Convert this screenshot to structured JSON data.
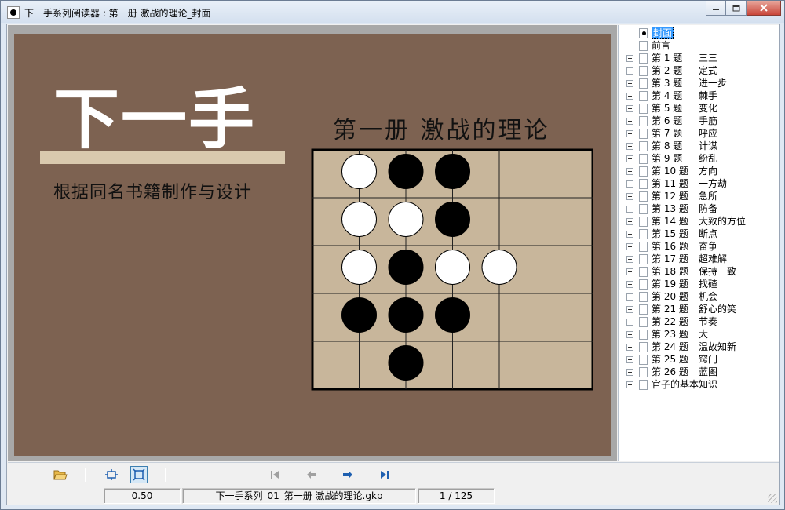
{
  "window": {
    "title": "下一手系列阅读器 : 第一册  激战的理论_封面",
    "min_icon": "minimize-icon",
    "max_icon": "maximize-icon",
    "close_icon": "close-icon"
  },
  "page": {
    "big_title": "下一手",
    "subtitle": "根据同名书籍制作与设计",
    "book_title": "第一册  激战的理论",
    "background_color": "#7d6251",
    "board_color": "#c8b69b"
  },
  "board": {
    "columns": 6,
    "rows": 5,
    "stones": [
      {
        "col": 1,
        "row": 1,
        "color": "white"
      },
      {
        "col": 2,
        "row": 1,
        "color": "black"
      },
      {
        "col": 3,
        "row": 1,
        "color": "black"
      },
      {
        "col": 1,
        "row": 2,
        "color": "white"
      },
      {
        "col": 2,
        "row": 2,
        "color": "white"
      },
      {
        "col": 3,
        "row": 2,
        "color": "black"
      },
      {
        "col": 1,
        "row": 3,
        "color": "white"
      },
      {
        "col": 2,
        "row": 3,
        "color": "black"
      },
      {
        "col": 3,
        "row": 3,
        "color": "white"
      },
      {
        "col": 4,
        "row": 3,
        "color": "white"
      },
      {
        "col": 1,
        "row": 4,
        "color": "black"
      },
      {
        "col": 2,
        "row": 4,
        "color": "black"
      },
      {
        "col": 3,
        "row": 4,
        "color": "black"
      },
      {
        "col": 2,
        "row": 5,
        "color": "black"
      }
    ]
  },
  "tree": {
    "items": [
      {
        "label": "封面",
        "selected": true,
        "expandable": false
      },
      {
        "label": "前言",
        "selected": false,
        "expandable": false
      },
      {
        "num": "第 1 题",
        "title": "三三",
        "expandable": true
      },
      {
        "num": "第 2 题",
        "title": "定式",
        "expandable": true
      },
      {
        "num": "第 3 题",
        "title": "进一步",
        "expandable": true
      },
      {
        "num": "第 4 题",
        "title": "棘手",
        "expandable": true
      },
      {
        "num": "第 5 题",
        "title": "变化",
        "expandable": true
      },
      {
        "num": "第 6 题",
        "title": "手筋",
        "expandable": true
      },
      {
        "num": "第 7 题",
        "title": "呼应",
        "expandable": true
      },
      {
        "num": "第 8 题",
        "title": "计谋",
        "expandable": true
      },
      {
        "num": "第 9 题",
        "title": "纷乱",
        "expandable": true
      },
      {
        "num": "第 10 题",
        "title": "方向",
        "expandable": true
      },
      {
        "num": "第 11 题",
        "title": "一方劫",
        "expandable": true
      },
      {
        "num": "第 12 题",
        "title": "急所",
        "expandable": true
      },
      {
        "num": "第 13 题",
        "title": "防备",
        "expandable": true
      },
      {
        "num": "第 14 题",
        "title": "大致的方位",
        "expandable": true
      },
      {
        "num": "第 15 题",
        "title": "断点",
        "expandable": true
      },
      {
        "num": "第 16 题",
        "title": "奋争",
        "expandable": true
      },
      {
        "num": "第 17 题",
        "title": "超难解",
        "expandable": true
      },
      {
        "num": "第 18 题",
        "title": "保持一致",
        "expandable": true
      },
      {
        "num": "第 19 题",
        "title": "找碴",
        "expandable": true
      },
      {
        "num": "第 20 题",
        "title": "机会",
        "expandable": true
      },
      {
        "num": "第 21 题",
        "title": "舒心的笑",
        "expandable": true
      },
      {
        "num": "第 22 题",
        "title": "节奏",
        "expandable": true
      },
      {
        "num": "第 23 题",
        "title": "大",
        "expandable": true
      },
      {
        "num": "第 24 题",
        "title": "温故知新",
        "expandable": true
      },
      {
        "num": "第 25 题",
        "title": "窍门",
        "expandable": true
      },
      {
        "num": "第 26 题",
        "title": "蓝图",
        "expandable": true
      },
      {
        "label": "官子的基本知识",
        "expandable": true
      }
    ]
  },
  "toolbar": {
    "open_icon": "open-folder-icon",
    "fit_width_icon": "fit-width-icon",
    "fit_page_icon": "fit-page-icon",
    "first_icon": "first-page-icon",
    "prev_icon": "prev-page-icon",
    "next_icon": "next-page-icon",
    "last_icon": "last-page-icon"
  },
  "status": {
    "zoom": "0.50",
    "file": "下一手系列_01_第一册  激战的理论.gkp",
    "page": "1 / 125"
  }
}
